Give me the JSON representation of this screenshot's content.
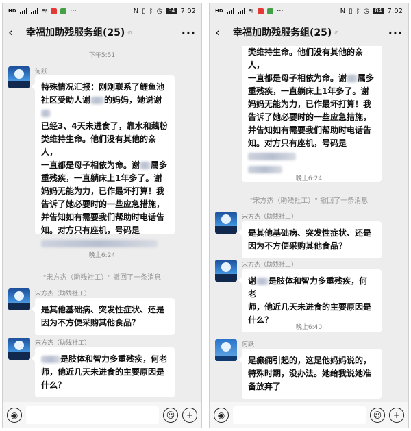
{
  "status": {
    "time": "7:02",
    "battery": "84",
    "signal": "HD"
  },
  "header": {
    "back_glyph": "‹",
    "title": "幸福加助残服务组(25)",
    "mute_glyph": "⌀",
    "more_glyph": "···"
  },
  "left": {
    "time1": "下午5:51",
    "msg1": {
      "sender": "何跃",
      "lines": [
        "特殊情况汇报：刚刚联系了鲤鱼池",
        "社区受助人谢",
        "的妈妈，她说谢",
        "已经3、4天未进食了，靠水和藕粉",
        "类维持生命。他们没有其他的亲人，",
        "一直都是母子相依为命。谢",
        "属多",
        "重残疾，一直躺床上1年多了。谢",
        "妈妈无能为力，已作最坏打算！我",
        "告诉了她必要时的一些应急措施，",
        "并告知如有需要我们帮助时电话告",
        "知。对方只有座机，号码是"
      ]
    },
    "time2": "晚上6:24",
    "recall": "\"宋方杰（助残社工）\" 撤回了一条消息",
    "msg2": {
      "sender": "宋方杰（助残社工）",
      "lines": [
        "是其他基础病、突发性症状、还是",
        "因为不方便采购其他食品？"
      ]
    },
    "msg3": {
      "sender": "宋方杰（助残社工）",
      "lines": [
        "是肢体和智力多重残疾，何老",
        "师，他近几天未进食的主要原因是",
        "什么？"
      ]
    }
  },
  "right": {
    "msg1_tail": {
      "lines": [
        "类维持生命。他们没有其他的亲人，",
        "一直都是母子相依为命。谢",
        "属多",
        "重残疾，一直躺床上1年多了。谢",
        "妈妈无能为力，已作最坏打算！我",
        "告诉了她必要时的一些应急措施，",
        "并告知如有需要我们帮助时电话告",
        "知。对方只有座机，号码是"
      ]
    },
    "time1": "晚上6:24",
    "recall": "\"宋方杰（助残社工）\" 撤回了一条消息",
    "msg2": {
      "sender": "宋方杰（助残社工）",
      "lines": [
        "是其他基础病、突发性症状、还是",
        "因为不方便采购其他食品？"
      ]
    },
    "msg3": {
      "sender": "宋方杰（助残社工）",
      "lines": [
        "谢",
        "是肢体和智力多重残疾，何老",
        "师，他近几天未进食的主要原因是",
        "什么？"
      ]
    },
    "time2": "晚上6:40",
    "msg4": {
      "sender": "何跃",
      "lines": [
        "是癫痫引起的，这是他妈妈说的，",
        "特殊时期，没办法。她给我说她准",
        "备放弃了"
      ]
    }
  },
  "input": {
    "voice_glyph": "◉",
    "emoji_glyph": "☺",
    "plus_glyph": "+"
  },
  "colors": {
    "chat_bg": "#ededed",
    "bubble": "#ffffff",
    "meta_text": "#888888"
  }
}
